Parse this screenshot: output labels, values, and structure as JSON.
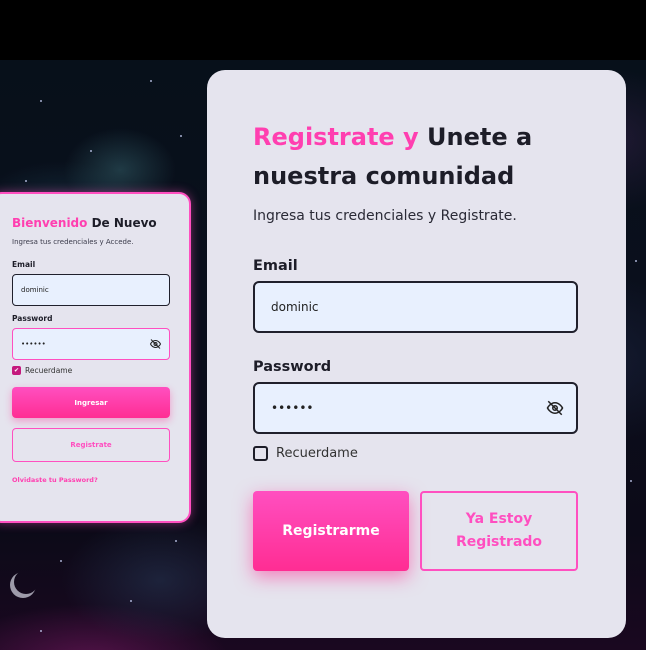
{
  "colors": {
    "accent": "#ff3fb0",
    "card_bg": "#e5e4ee",
    "input_bg": "#e8f0fe",
    "text_dark": "#1d1d28"
  },
  "login_card": {
    "title_accent": "Bienvenido",
    "title_rest": " De Nuevo",
    "subtitle": "Ingresa tus credenciales y Accede.",
    "email_label": "Email",
    "email_value": "dominic",
    "password_label": "Password",
    "password_value": "••••••",
    "remember_label": "Recuerdame",
    "remember_checked": true,
    "login_button": "Ingresar",
    "register_button": "Registrate",
    "forgot_link": "Olvidaste tu Password?"
  },
  "register_card": {
    "title_accent": "Registrate y",
    "title_rest": " Unete a nuestra comunidad",
    "subtitle": "Ingresa tus credenciales y Registrate.",
    "email_label": "Email",
    "email_value": "dominic",
    "password_label": "Password",
    "password_value": "••••••",
    "remember_label": "Recuerdame",
    "remember_checked": false,
    "register_button": "Registrarme",
    "already_button": "Ya Estoy Registrado"
  },
  "icons": {
    "password_toggle": "eye-slash-icon",
    "checkbox_check": "check-icon"
  }
}
